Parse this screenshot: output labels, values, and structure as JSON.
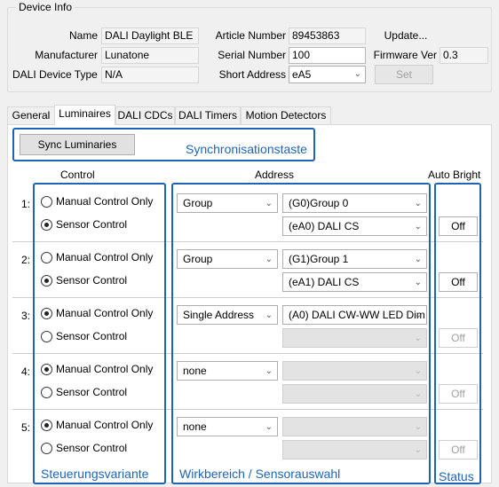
{
  "device_info": {
    "legend": "Device Info",
    "name_label": "Name",
    "name_value": "DALI Daylight BLE",
    "manufacturer_label": "Manufacturer",
    "manufacturer_value": "Lunatone",
    "device_type_label": "DALI Device Type",
    "device_type_value": "N/A",
    "article_label": "Article Number",
    "article_value": "89453863",
    "serial_label": "Serial Number",
    "serial_value": "100",
    "short_address_label": "Short Address",
    "short_address_value": "eA5",
    "update_label": "Update...",
    "firmware_label": "Firmware Ver",
    "firmware_value": "0.3",
    "set_label": "Set"
  },
  "tabs": [
    "General",
    "Luminaires",
    "DALI CDCs",
    "DALI Timers",
    "Motion Detectors"
  ],
  "active_tab": "Luminaires",
  "sync_button": "Sync Luminaries",
  "headers": {
    "control": "Control",
    "address": "Address",
    "auto_bright": "Auto Bright"
  },
  "radio_labels": {
    "manual": "Manual Control Only",
    "sensor": "Sensor Control"
  },
  "rows": [
    {
      "num": "1:",
      "mode": "sensor",
      "type": "Group",
      "target": "(G0)Group 0",
      "sensor": "(eA0) DALI CS",
      "sensor_enabled": true,
      "auto_bright": "Off",
      "auto_bright_enabled": true
    },
    {
      "num": "2:",
      "mode": "sensor",
      "type": "Group",
      "target": "(G1)Group 1",
      "sensor": "(eA1) DALI CS",
      "sensor_enabled": true,
      "auto_bright": "Off",
      "auto_bright_enabled": true
    },
    {
      "num": "3:",
      "mode": "manual",
      "type": "Single Address",
      "target": "(A0) DALI CW-WW LED Dim",
      "sensor": "",
      "sensor_enabled": false,
      "auto_bright": "Off",
      "auto_bright_enabled": false
    },
    {
      "num": "4:",
      "mode": "manual",
      "type": "none",
      "target": "",
      "sensor": "",
      "sensor_enabled": false,
      "auto_bright": "Off",
      "auto_bright_enabled": false
    },
    {
      "num": "5:",
      "mode": "manual",
      "type": "none",
      "target": "",
      "sensor": "",
      "sensor_enabled": false,
      "auto_bright": "Off",
      "auto_bright_enabled": false
    }
  ],
  "annotations": {
    "sync": "Synchronisationstaste",
    "control": "Steuerungsvariante",
    "address": "Wirkbereich / Sensorauswahl",
    "status": "Status"
  },
  "colors": {
    "annotation_blue": "#1f64b4"
  }
}
